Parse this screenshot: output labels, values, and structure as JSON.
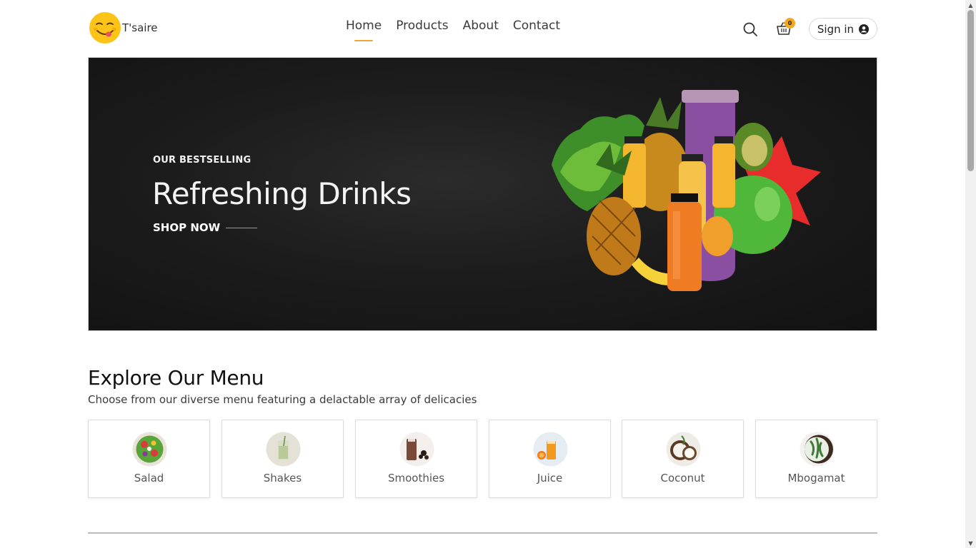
{
  "brand": {
    "name": "T'saire"
  },
  "nav": {
    "items": [
      {
        "label": "Home",
        "active": true
      },
      {
        "label": "Products",
        "active": false
      },
      {
        "label": "About",
        "active": false
      },
      {
        "label": "Contact",
        "active": false
      }
    ]
  },
  "actions": {
    "search_icon": "search-icon",
    "cart_icon": "basket-icon",
    "cart_count": "0",
    "signin_label": "Sign in",
    "user_icon": "user-circle-icon"
  },
  "hero": {
    "kicker": "OUR BESTSELLING",
    "title": "Refreshing Drinks",
    "cta": "SHOP NOW"
  },
  "menu": {
    "title": "Explore Our Menu",
    "subtitle": "Choose from our diverse menu featuring a delactable array of delicacies",
    "items": [
      {
        "label": "Salad"
      },
      {
        "label": "Shakes"
      },
      {
        "label": "Smoothies"
      },
      {
        "label": "Juice"
      },
      {
        "label": "Coconut"
      },
      {
        "label": "Mbogamat"
      }
    ]
  },
  "colors": {
    "accent": "#f0a53a",
    "badge": "#f4a81d",
    "hero_bg": "#1c1c1c",
    "logo_yellow": "#fcc419"
  }
}
